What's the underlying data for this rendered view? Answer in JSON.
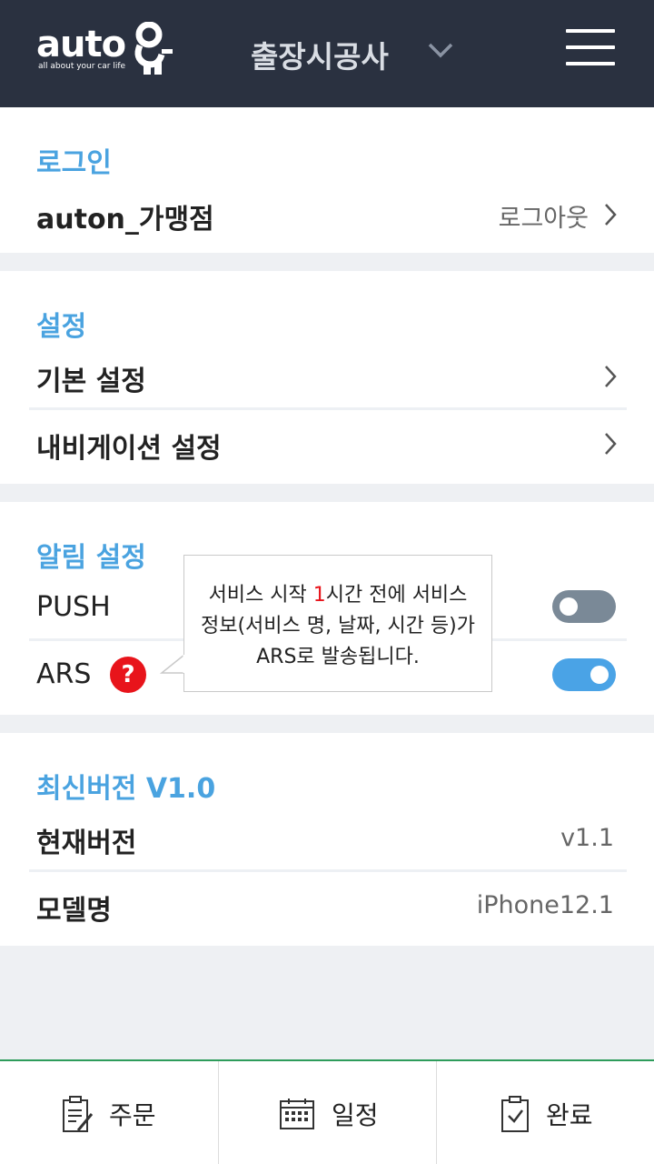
{
  "header": {
    "logo_text": "auto",
    "logo_tagline": "all about your car life",
    "title": "출장시공사",
    "menu_icon": "hamburger-menu-icon",
    "dropdown_icon": "chevron-down-icon"
  },
  "login": {
    "section_title": "로그인",
    "account_name": "auton_가맹점",
    "logout_label": "로그아웃"
  },
  "settings": {
    "section_title": "설정",
    "items": [
      {
        "label": "기본 설정"
      },
      {
        "label": "내비게이션 설정"
      }
    ]
  },
  "notifications": {
    "section_title": "알림 설정",
    "push": {
      "label": "PUSH",
      "enabled": false
    },
    "ars": {
      "label": "ARS",
      "enabled": true,
      "help_symbol": "?"
    },
    "tooltip": {
      "line1_before": "서비스 시작 ",
      "line1_highlight": "1",
      "line1_after": "시간 전에 서비스",
      "line2": "정보(서비스 명, 날짜, 시간 등)가",
      "line3": "ARS로 발송됩니다."
    }
  },
  "version": {
    "section_title": "최신버전 V1.0",
    "current_label": "현재버전",
    "current_value": "v1.1",
    "model_label": "모델명",
    "model_value": "iPhone12.1"
  },
  "bottom_nav": {
    "items": [
      {
        "label": "주문",
        "icon": "clipboard-edit-icon"
      },
      {
        "label": "일정",
        "icon": "calendar-icon"
      },
      {
        "label": "완료",
        "icon": "clipboard-check-icon"
      }
    ]
  },
  "colors": {
    "header_bg": "#2a3140",
    "accent_blue": "#4aa3e0",
    "toggle_on": "#4aa3e6",
    "toggle_off": "#7a8997",
    "help_red": "#e8141b",
    "nav_top_border": "#2e9c5b"
  }
}
